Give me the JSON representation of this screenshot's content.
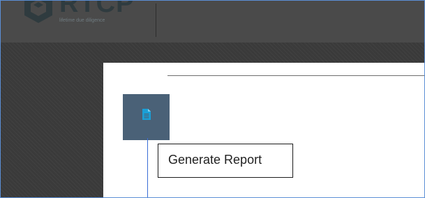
{
  "header": {
    "logo_text": "RTCP",
    "logo_tagline": "lifetime due diligence",
    "logo_icon": "cube-logo-icon",
    "background_color": "#4a4a4a"
  },
  "content": {
    "report_button": {
      "icon": "document-icon",
      "background_color": "#4a6177",
      "icon_color": "#1a9fd6"
    },
    "tooltip": {
      "text": "Generate Report"
    }
  },
  "colors": {
    "page_background": "#3a3a3a",
    "panel_background": "#ffffff",
    "frame_border": "#5b8fd6",
    "pointer_line": "#3b6ed6"
  }
}
